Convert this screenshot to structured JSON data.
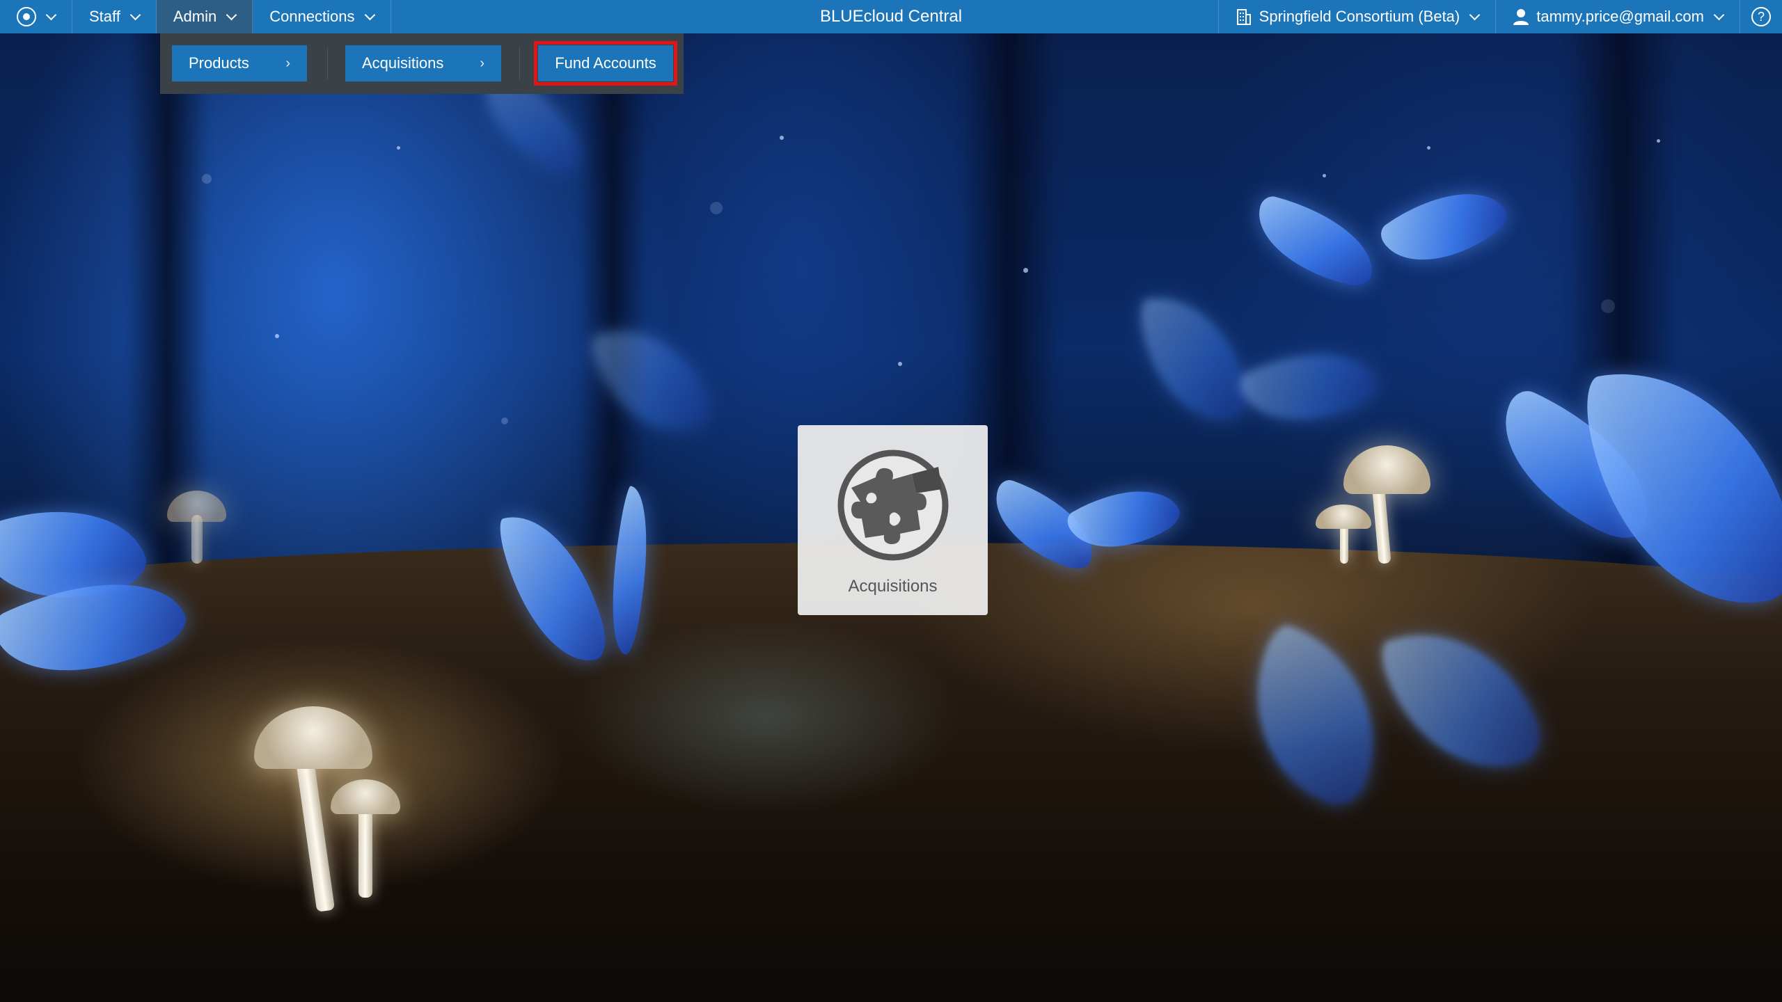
{
  "topbar": {
    "app_title": "BLUEcloud Central",
    "nav": [
      {
        "label": "Staff"
      },
      {
        "label": "Admin"
      },
      {
        "label": "Connections"
      }
    ],
    "consortium": "Springfield Consortium (Beta)",
    "user": "tammy.price@gmail.com",
    "help_glyph": "?"
  },
  "admin_menu": {
    "items": [
      {
        "label": "Products",
        "has_submenu": true
      },
      {
        "label": "Acquisitions",
        "has_submenu": true
      },
      {
        "label": "Fund Accounts",
        "has_submenu": false,
        "highlighted": true
      }
    ],
    "arrow_glyph": "›"
  },
  "tile": {
    "label": "Acquisitions",
    "icon": "puzzle-globe-icon"
  },
  "colors": {
    "topbar": "#1b75b8",
    "admin_active": "#2d5f86",
    "menu_bg": "#3a4147",
    "highlight": "#e01515"
  }
}
